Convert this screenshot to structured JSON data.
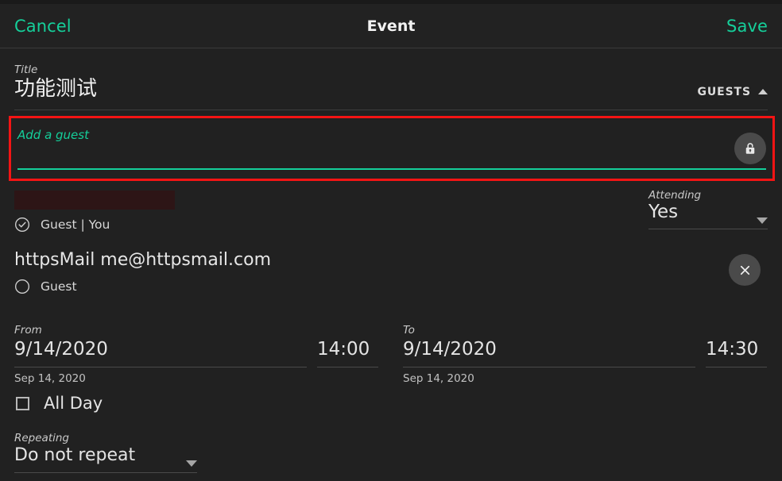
{
  "header": {
    "cancel_label": "Cancel",
    "title": "Event",
    "save_label": "Save",
    "accent_color": "#15cf9a"
  },
  "title_field": {
    "label": "Title",
    "value": "功能测试"
  },
  "guests_section": {
    "toggle_label": "GUESTS",
    "toggle_icon": "caret-up-icon",
    "add_guest": {
      "placeholder": "Add a guest",
      "value": "",
      "lock_icon": "lock-icon",
      "highlight_color": "#f41414"
    },
    "guests": [
      {
        "name_redacted": true,
        "name": "",
        "role": "Guest | You",
        "status_icon": "check-circle-icon",
        "attending": {
          "label": "Attending",
          "value": "Yes",
          "icon": "caret-down-icon"
        }
      },
      {
        "name_redacted": false,
        "name": "httpsMail me@httpsmail.com",
        "role": "Guest",
        "status_icon": "empty-circle-icon",
        "remove_icon": "close-icon"
      }
    ]
  },
  "from_field": {
    "label": "From",
    "date": "9/14/2020",
    "time": "14:00",
    "hint": "Sep 14, 2020"
  },
  "to_field": {
    "label": "To",
    "date": "9/14/2020",
    "time": "14:30",
    "hint": "Sep 14, 2020"
  },
  "all_day": {
    "label": "All Day",
    "checked": false
  },
  "repeating": {
    "label": "Repeating",
    "value": "Do not repeat",
    "icon": "caret-down-icon"
  }
}
